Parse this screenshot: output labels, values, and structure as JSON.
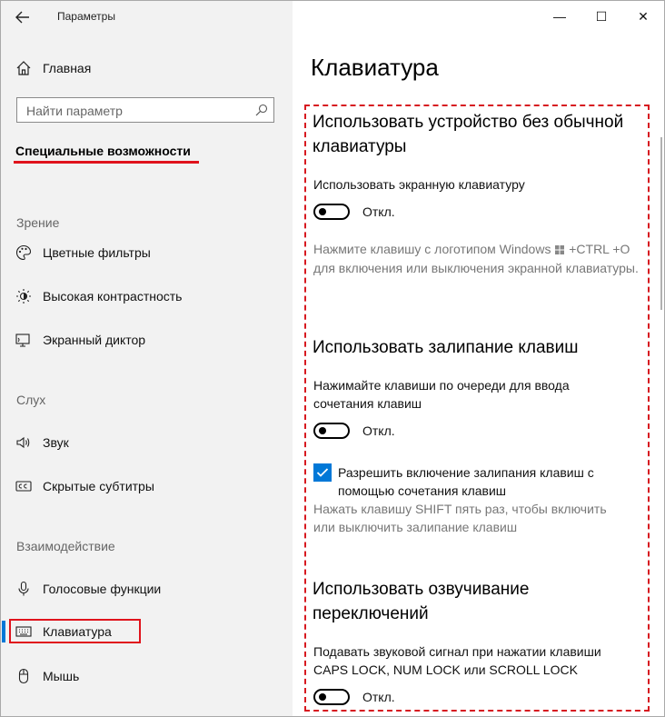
{
  "window": {
    "title": "Параметры",
    "minimize_glyph": "—",
    "maximize_glyph": "☐",
    "close_glyph": "✕"
  },
  "sidebar": {
    "home_label": "Главная",
    "search_placeholder": "Найти параметр",
    "section_title": "Специальные возможности",
    "groups": {
      "vision": "Зрение",
      "hearing": "Слух",
      "interaction": "Взаимодействие"
    },
    "items": [
      {
        "label": "Цветные фильтры",
        "icon": "color-filter-icon"
      },
      {
        "label": "Высокая контрастность",
        "icon": "high-contrast-icon"
      },
      {
        "label": "Экранный диктор",
        "icon": "narrator-icon"
      },
      {
        "label": "Звук",
        "icon": "speaker-icon"
      },
      {
        "label": "Скрытые субтитры",
        "icon": "closed-captions-icon"
      },
      {
        "label": "Голосовые функции",
        "icon": "microphone-icon"
      },
      {
        "label": "Клавиатура",
        "icon": "keyboard-icon",
        "active": true
      },
      {
        "label": "Мышь",
        "icon": "mouse-icon"
      }
    ]
  },
  "main": {
    "page_title": "Клавиатура",
    "onscreen": {
      "heading": "Использовать устройство без обычной клавиатуры",
      "toggle_label": "Использовать экранную клавиатуру",
      "toggle_state": "Откл.",
      "hint_part1": "Нажмите клавишу с логотипом Windows",
      "hint_part2": "+CTRL +O для включения или выключения экранной клавиатуры."
    },
    "sticky": {
      "heading": "Использовать залипание клавиш",
      "toggle_label": "Нажимайте клавиши по очереди для ввода сочетания клавиш",
      "toggle_state": "Откл.",
      "checkbox_label": "Разрешить включение залипания клавиш с помощью сочетания клавиш",
      "checkbox_hint": "Нажать клавишу SHIFT пять раз, чтобы включить или выключить залипание клавиш"
    },
    "toggle_keys": {
      "heading": "Использовать озвучивание переключений",
      "toggle_label": "Подавать звуковой сигнал при нажатии клавиши CAPS LOCK, NUM LOCK или SCROLL LOCK",
      "toggle_state": "Откл."
    }
  },
  "colors": {
    "accent": "#0078d7",
    "highlight_red": "#e0131c",
    "sidebar_bg": "#f2f2f2"
  }
}
